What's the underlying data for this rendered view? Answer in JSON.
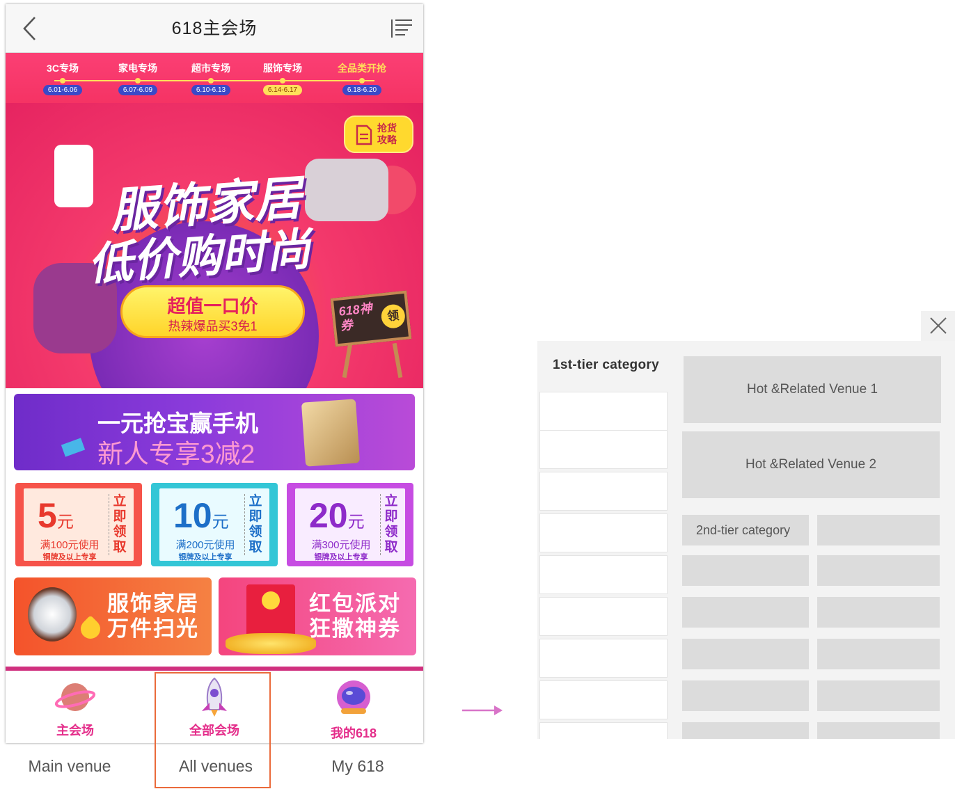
{
  "nav": {
    "title": "618主会场"
  },
  "timeline": [
    {
      "name": "3C专场",
      "date": "6.01-6.06",
      "active": false
    },
    {
      "name": "家电专场",
      "date": "6.07-6.09",
      "active": false
    },
    {
      "name": "超市专场",
      "date": "6.10-6.13",
      "active": false
    },
    {
      "name": "服饰专场",
      "date": "6.14-6.17",
      "active": true
    },
    {
      "name": "全品类开抢",
      "date": "6.18-6.20",
      "active": false
    }
  ],
  "hero": {
    "line1": "服饰家居",
    "line2": "低价购时尚",
    "badge_title": "超值一口价",
    "badge_sub": "热辣爆品买3免1",
    "guide_label": "抢货攻略",
    "board_text": "618神券",
    "board_seal": "领"
  },
  "promo": {
    "line1": "一元抢宝赢手机",
    "line2": "新人专享3减2"
  },
  "coupons": [
    {
      "amount": "5",
      "unit": "元",
      "condition": "满100元使用",
      "note": "铜牌及以上专享",
      "action": "立即领取"
    },
    {
      "amount": "10",
      "unit": "元",
      "condition": "满200元使用",
      "note": "银牌及以上专享",
      "action": "立即领取"
    },
    {
      "amount": "20",
      "unit": "元",
      "condition": "满300元使用",
      "note": "银牌及以上专享",
      "action": "立即领取"
    }
  ],
  "features": [
    {
      "line1": "服饰家居",
      "line2": "万件扫光"
    },
    {
      "line1": "红包派对",
      "line2": "狂撒神券"
    }
  ],
  "tabs": [
    {
      "label": "主会场",
      "caption": "Main venue"
    },
    {
      "label": "全部会场",
      "caption": "All venues"
    },
    {
      "label": "我的618",
      "caption": "My 618"
    }
  ],
  "panel": {
    "category_heading": "1st-tier category",
    "venues": [
      "Hot &Related Venue 1",
      "Hot &Related Venue 2"
    ],
    "subcategory_label": "2nd-tier category"
  },
  "colors": {
    "accent_pink": "#e42d8a",
    "timeline_bg": "#f53364",
    "timeline_dot": "#ffe05a",
    "highlight_border": "#ea6a3a",
    "arrow": "#d874c8"
  }
}
